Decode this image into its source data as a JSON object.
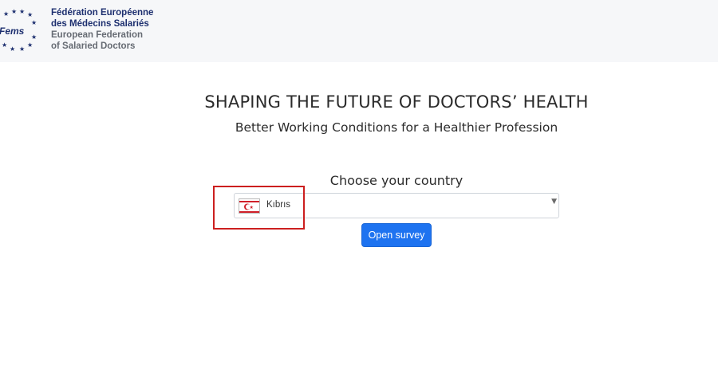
{
  "header": {
    "logo_icon": "fems-eu-stars-logo-icon",
    "logo_mark_text": "Fems",
    "name_fr_line1": "Fédération Européenne",
    "name_fr_line2": "des Médecins Salariés",
    "name_en_line1": "European Federation",
    "name_en_line2": "of Salaried Doctors"
  },
  "main": {
    "title": "SHAPING THE FUTURE OF DOCTORS’ HEALTH",
    "subtitle": "Better Working Conditions for a Healthier Profession"
  },
  "country": {
    "label": "Choose your country",
    "selected_value": "Kıbrıs",
    "flag_icon": "cyprus-flag-icon",
    "dropdown_icon": "caret-down-icon"
  },
  "actions": {
    "open_survey_label": "Open survey"
  },
  "colors": {
    "header_bg": "#f6f7f9",
    "brand_navy": "#1d2f6f",
    "button_blue": "#1e73f0",
    "highlight_red": "#cc1f1f"
  }
}
